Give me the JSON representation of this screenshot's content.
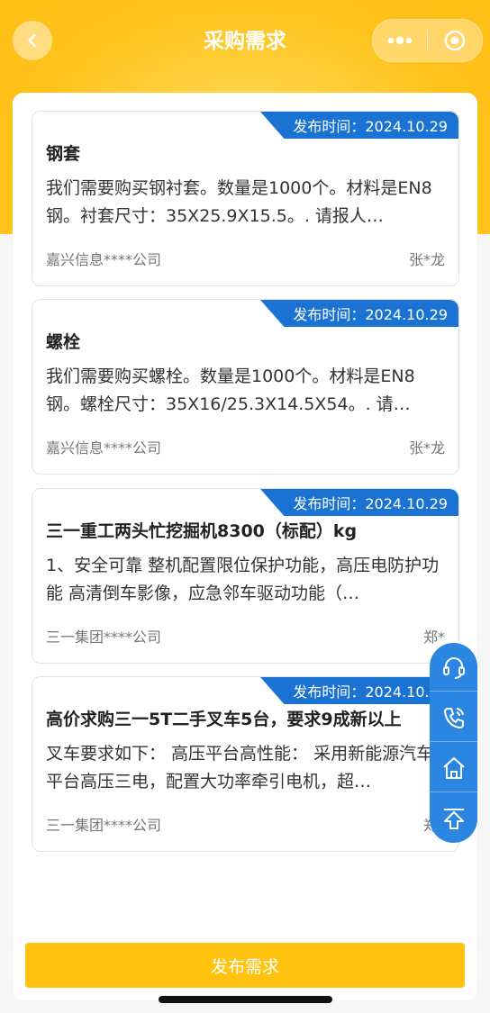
{
  "header": {
    "title": "采购需求",
    "more_icon": "more-dots-icon",
    "target_icon": "target-icon",
    "back_icon": "chevron-left-icon"
  },
  "cards": [
    {
      "date": "发布时间：2024.10.29",
      "title": "钢套",
      "desc": "我们需要购买钢衬套。数量是1000个。材料是EN8钢。衬套尺寸：35X25.9X15.5。. 请报人…",
      "company": "嘉兴信息****公司",
      "person": "张*龙"
    },
    {
      "date": "发布时间：2024.10.29",
      "title": "螺栓",
      "desc": "我们需要购买螺栓。数量是1000个。材料是EN8钢。螺栓尺寸：35X16/25.3X14.5X54。. 请…",
      "company": "嘉兴信息****公司",
      "person": "张*龙"
    },
    {
      "date": "发布时间：2024.10.29",
      "title": "三一重工两头忙挖掘机8300（标配）kg",
      "desc": "1、安全可靠 整机配置限位保护功能，高压电防护功能 高清倒车影像，应急邻车驱动功能（…",
      "company": "三一集团****公司",
      "person": "郑*"
    },
    {
      "date": "发布时间：2024.10.21",
      "title": "高价求购三一5T二手叉车5台，要求9成新以上",
      "desc": "叉车要求如下： 高压平台高性能： 采用新能源汽车平台高压三电，配置大功率牵引电机，超…",
      "company": "三一集团****公司",
      "person": "郑*"
    }
  ],
  "float_bar": {
    "items": [
      "headset-icon",
      "phone-icon",
      "home-icon",
      "back-to-top-icon"
    ]
  },
  "publish_button": "发布需求",
  "colors": {
    "brand_yellow": "#ffc20e",
    "tag_blue": "#1a73d3",
    "float_blue": "#2a86e0"
  }
}
